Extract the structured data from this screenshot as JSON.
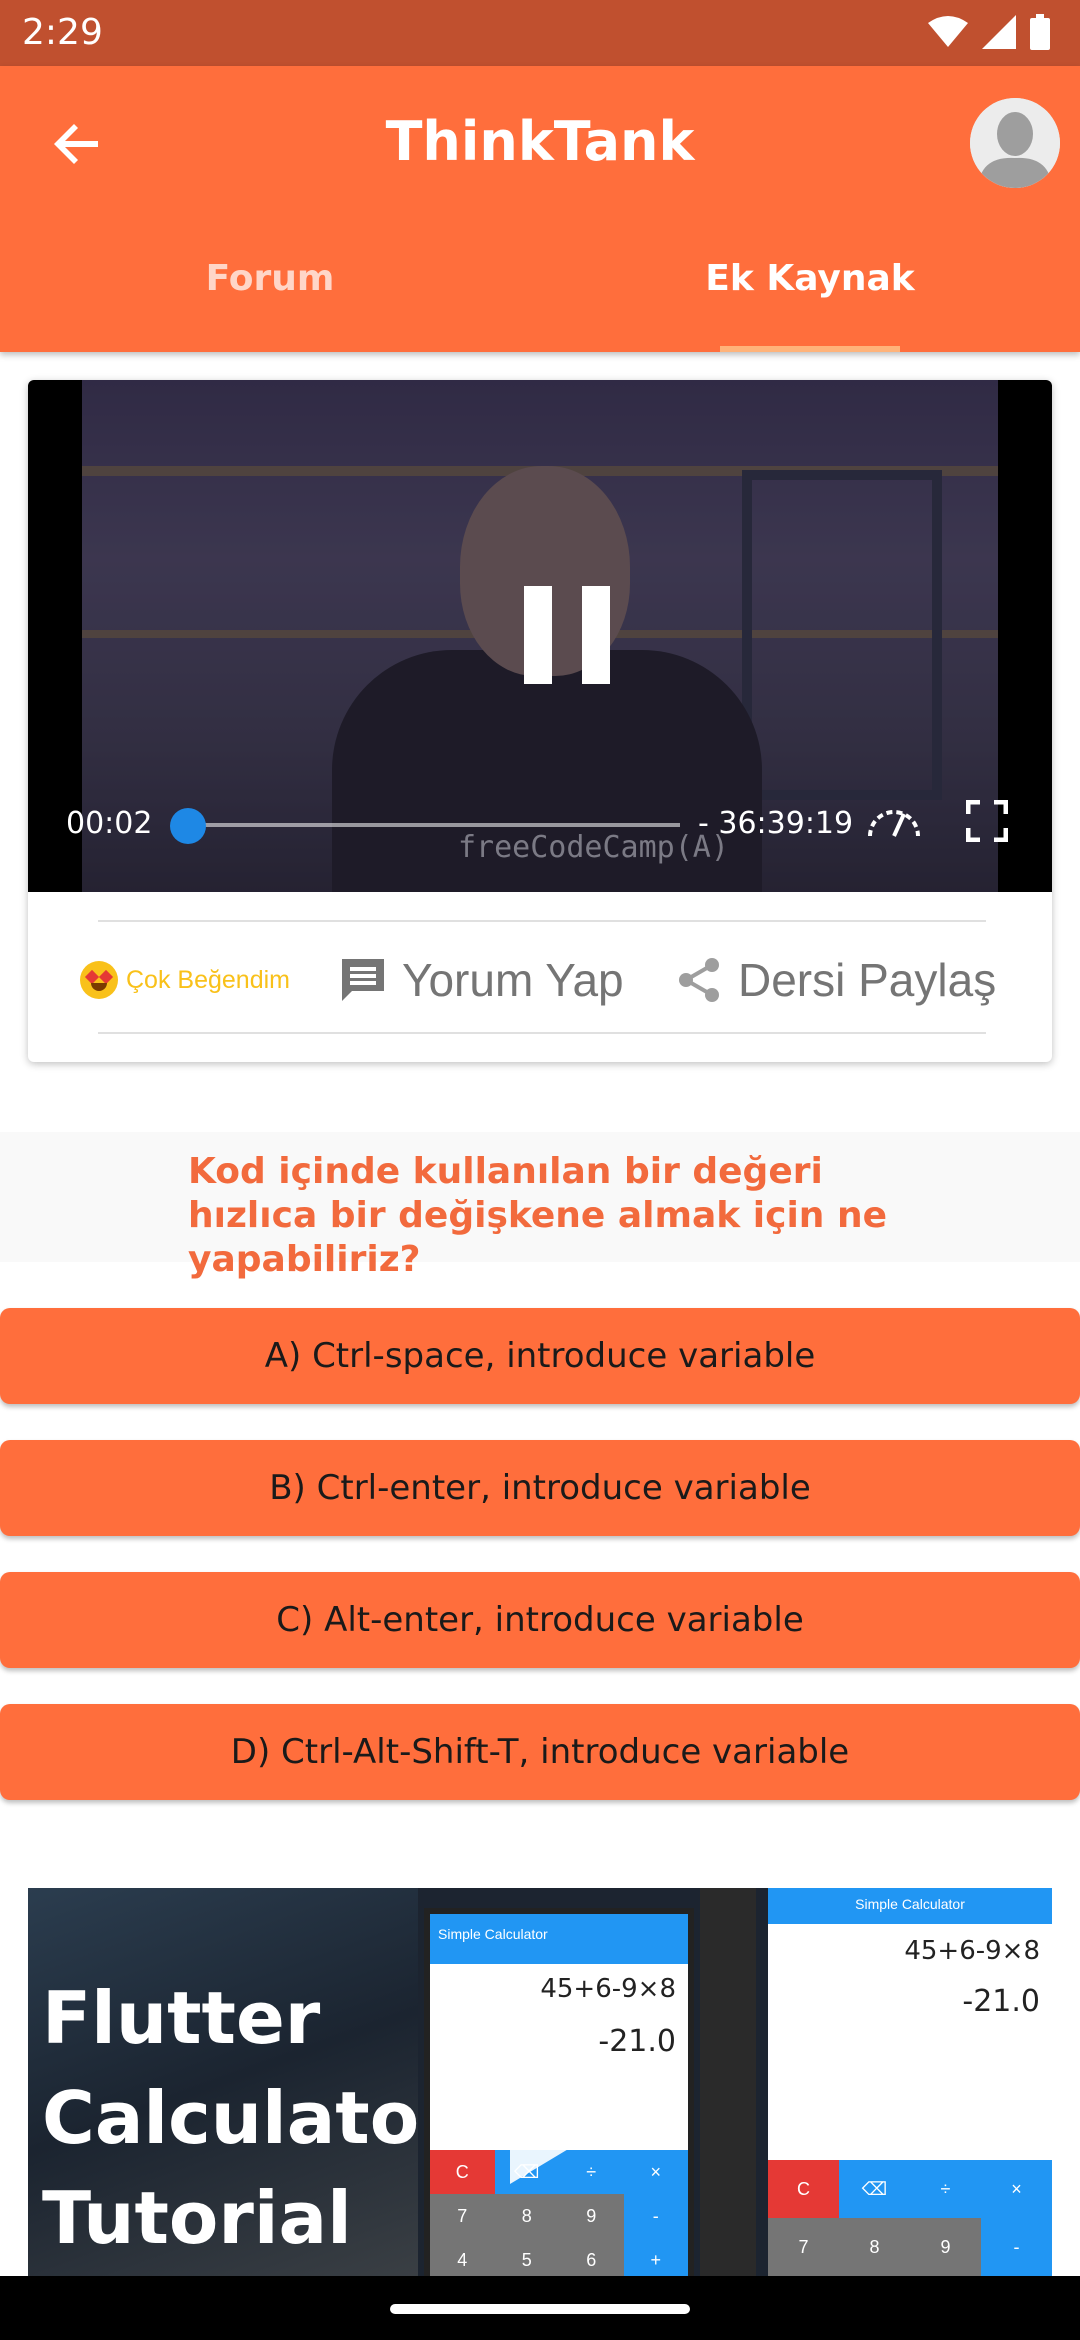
{
  "status_bar": {
    "time": "2:29"
  },
  "app_bar": {
    "title": "ThinkTank"
  },
  "tabs": [
    {
      "label": "Forum",
      "selected": false
    },
    {
      "label": "Ek Kaynak",
      "selected": true
    }
  ],
  "video": {
    "current_time": "00:02",
    "remaining_time": "- 36:39:19",
    "watermark": "freeCodeCamp(A)",
    "state": "playing"
  },
  "actions": {
    "like_label": "Çok Beğendim",
    "comment_label": "Yorum Yap",
    "share_label": "Dersi Paylaş"
  },
  "question": {
    "text": "Kod içinde kullanılan bir değeri hızlıca bir değişkene almak için ne yapabiliriz?"
  },
  "answers": [
    "A) Ctrl-space, introduce variable",
    "B) Ctrl-enter, introduce variable",
    "C) Alt-enter, introduce variable",
    "D) Ctrl-Alt-Shift-T, introduce variable"
  ],
  "video2": {
    "thumbnail_title_lines": [
      "Flutter",
      "Calculator",
      "Tutorial"
    ],
    "phone_app_title": "Simple Calculator",
    "expression": "45+6-9×8",
    "result": "-21.0",
    "keypad_rows": [
      [
        "C",
        "⌫",
        "÷",
        "×"
      ],
      [
        "7",
        "8",
        "9",
        "-"
      ],
      [
        "4",
        "5",
        "6",
        "+"
      ]
    ]
  },
  "colors": {
    "primary": "#ff6e3c",
    "status_bar": "#c0502f",
    "question_text": "#f26a3d",
    "seek_thumb": "#1e88e5",
    "like_text": "#f9c11a"
  }
}
